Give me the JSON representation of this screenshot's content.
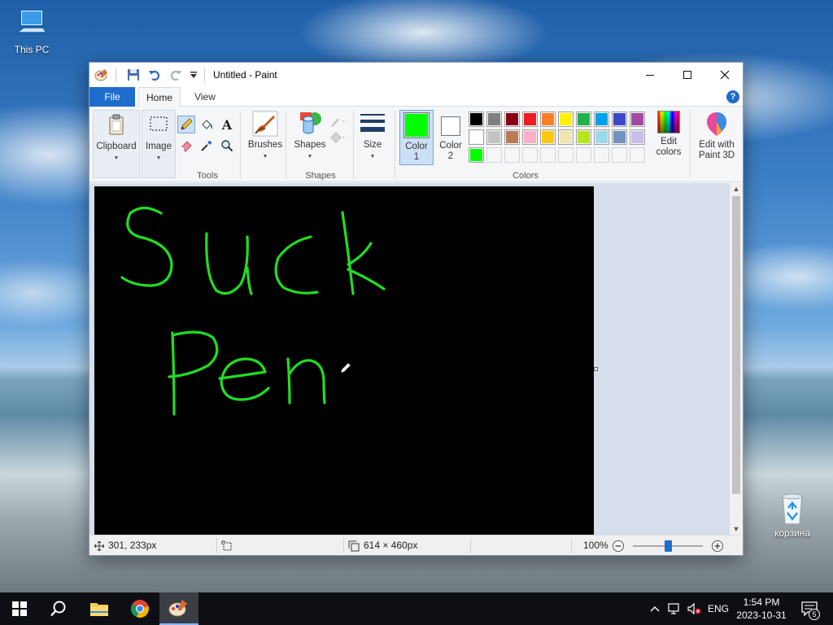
{
  "desktop": {
    "icons": [
      {
        "label": "This PC"
      },
      {
        "label": "корзина"
      }
    ]
  },
  "window": {
    "title": "Untitled - Paint",
    "tabs": [
      "File",
      "Home",
      "View"
    ],
    "help": "?",
    "ribbon": {
      "clipboard": {
        "label": "Clipboard"
      },
      "image": {
        "label": "Image"
      },
      "tools": {
        "label": "Tools",
        "text_tool": "A"
      },
      "brushes": {
        "label": "Brushes"
      },
      "shapes": {
        "button_label": "Shapes",
        "group_label": "Shapes"
      },
      "size": {
        "label": "Size"
      },
      "color1": {
        "label": "Color",
        "number": "1",
        "value": "#00ff00"
      },
      "color2": {
        "label": "Color",
        "number": "2",
        "value": "#ffffff"
      },
      "colors_group_label": "Colors",
      "edit_colors": {
        "line1": "Edit",
        "line2": "colors"
      },
      "paint3d": {
        "line1": "Edit with",
        "line2": "Paint 3D"
      },
      "palette_row1": [
        "#000000",
        "#7f7f7f",
        "#880015",
        "#ed1c24",
        "#ff7f27",
        "#fff200",
        "#22b14c",
        "#00a2e8",
        "#3f48cc",
        "#a349a4"
      ],
      "palette_row2": [
        "#ffffff",
        "#c3c3c3",
        "#b97a57",
        "#ffaec9",
        "#ffc90e",
        "#efe4b0",
        "#b5e61d",
        "#99d9ea",
        "#7092be",
        "#c8bfe7"
      ],
      "palette_row3": [
        "#00ff00",
        "#f5f6f7",
        "#f5f6f7",
        "#f5f6f7",
        "#f5f6f7",
        "#f5f6f7",
        "#f5f6f7",
        "#f5f6f7",
        "#f5f6f7",
        "#f5f6f7"
      ]
    },
    "canvas": {
      "background": "#000000",
      "stroke_color": "#22dd22",
      "drawing_words": [
        "Suck",
        "Pen"
      ]
    },
    "status": {
      "cursor_position": "301, 233px",
      "canvas_size": "614 × 460px",
      "zoom": "100%",
      "zoom_level": 0.5
    }
  },
  "taskbar": {
    "language": "ENG",
    "time": "1:54 PM",
    "date": "2023-10-31",
    "notification_count": "5"
  }
}
